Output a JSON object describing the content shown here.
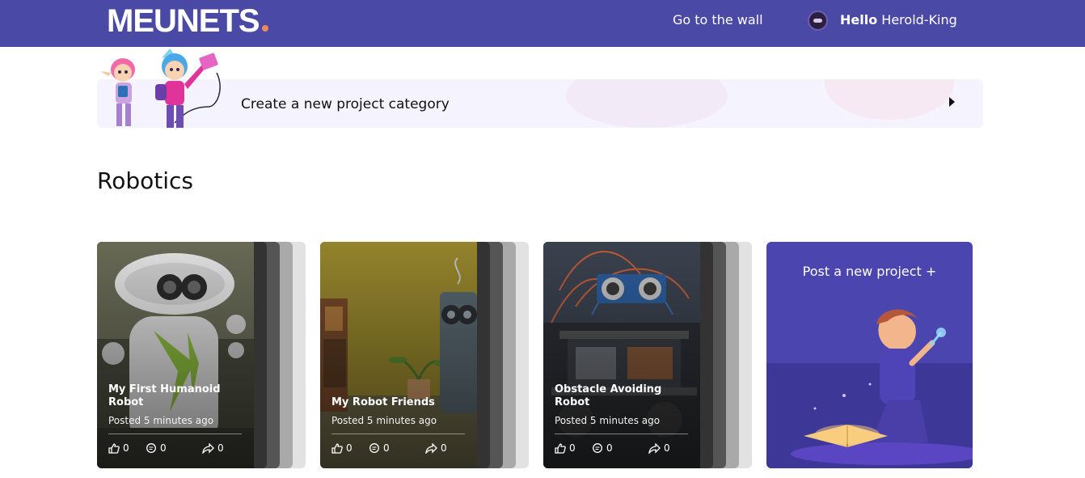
{
  "header": {
    "brand": "MEUNETS",
    "nav_wall": "Go to the wall",
    "greeting": "Hello",
    "username": "Herold-King",
    "colors": {
      "bar": "#4a4aa6",
      "brand_dot": "#f08a5d"
    }
  },
  "banner": {
    "label": "Create a new project category",
    "icons": {
      "arrow": "caret-right-icon"
    }
  },
  "section": {
    "title": "Robotics"
  },
  "projects": [
    {
      "title": "My First Humanoid Robot",
      "posted": "Posted 5 minutes ago",
      "likes": "0",
      "comments": "0",
      "shares": "0"
    },
    {
      "title": "My Robot Friends",
      "posted": "Posted 5 minutes ago",
      "likes": "0",
      "comments": "0",
      "shares": "0"
    },
    {
      "title": "Obstacle Avoiding Robot",
      "posted": "Posted 5 minutes ago",
      "likes": "0",
      "comments": "0",
      "shares": "0"
    }
  ],
  "stat_icons": [
    "thumbs-up-icon",
    "comment-icon",
    "share-icon"
  ],
  "post_card": {
    "label": "Post a new project +",
    "color": "#4b45b0"
  }
}
